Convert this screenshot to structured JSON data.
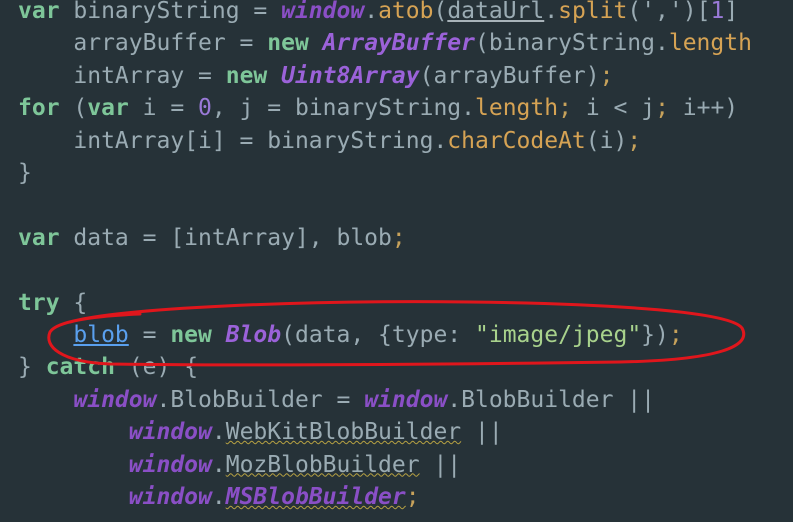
{
  "code_lines": [
    [
      {
        "t": "var",
        "c": "kw"
      },
      {
        "t": " binaryString = ",
        "c": "pl"
      },
      {
        "t": "window",
        "c": "bi"
      },
      {
        "t": ".",
        "c": "pl"
      },
      {
        "t": "atob",
        "c": "fn"
      },
      {
        "t": "(",
        "c": "pl"
      },
      {
        "t": "dataUrl",
        "c": "pl un"
      },
      {
        "t": ".",
        "c": "pl"
      },
      {
        "t": "split",
        "c": "fn"
      },
      {
        "t": "(','",
        "c": "pl"
      },
      {
        "t": ")[",
        "c": "pl"
      },
      {
        "t": "1",
        "c": "nu"
      },
      {
        "t": "]",
        "c": "pl"
      }
    ],
    [
      {
        "t": "    arrayBuffer = ",
        "c": "pl"
      },
      {
        "t": "new",
        "c": "kw"
      },
      {
        "t": " ",
        "c": "pl"
      },
      {
        "t": "ArrayBuffer",
        "c": "cl"
      },
      {
        "t": "(binaryString.",
        "c": "pl"
      },
      {
        "t": "length",
        "c": "fn"
      }
    ],
    [
      {
        "t": "    intArray = ",
        "c": "pl"
      },
      {
        "t": "new",
        "c": "kw"
      },
      {
        "t": " ",
        "c": "pl"
      },
      {
        "t": "Uint8Array",
        "c": "cl"
      },
      {
        "t": "(arrayBuffer)",
        "c": "pl"
      },
      {
        "t": ";",
        "c": "pu"
      }
    ],
    [
      {
        "t": "for",
        "c": "kw"
      },
      {
        "t": " (",
        "c": "pl"
      },
      {
        "t": "var",
        "c": "kw"
      },
      {
        "t": " i = ",
        "c": "pl"
      },
      {
        "t": "0",
        "c": "nu"
      },
      {
        "t": ", j = binaryString.",
        "c": "pl"
      },
      {
        "t": "length",
        "c": "fn"
      },
      {
        "t": ";",
        "c": "pu"
      },
      {
        "t": " i < j",
        "c": "pl"
      },
      {
        "t": ";",
        "c": "pu"
      },
      {
        "t": " i++)",
        "c": "pl"
      }
    ],
    [
      {
        "t": "    intArray[i] = binaryString.",
        "c": "pl"
      },
      {
        "t": "charCodeAt",
        "c": "fn"
      },
      {
        "t": "(i)",
        "c": "pl"
      },
      {
        "t": ";",
        "c": "pu"
      }
    ],
    [
      {
        "t": "}",
        "c": "pl"
      }
    ],
    [],
    [
      {
        "t": "var",
        "c": "kw"
      },
      {
        "t": " data = [intArray], blob",
        "c": "pl"
      },
      {
        "t": ";",
        "c": "pu"
      }
    ],
    [],
    [
      {
        "t": "try",
        "c": "kw"
      },
      {
        "t": " {",
        "c": "pl"
      }
    ],
    [
      {
        "t": "    ",
        "c": "pl"
      },
      {
        "t": "blob",
        "c": "blue"
      },
      {
        "t": " = ",
        "c": "pl"
      },
      {
        "t": "new",
        "c": "kw"
      },
      {
        "t": " ",
        "c": "pl"
      },
      {
        "t": "Blob",
        "c": "cl"
      },
      {
        "t": "(data, {type: ",
        "c": "pl"
      },
      {
        "t": "\"image/jpeg\"",
        "c": "st"
      },
      {
        "t": "})",
        "c": "pl"
      },
      {
        "t": ";",
        "c": "pu"
      }
    ],
    [
      {
        "t": "} ",
        "c": "pl"
      },
      {
        "t": "catch",
        "c": "kw"
      },
      {
        "t": " (e) {",
        "c": "pl"
      }
    ],
    [
      {
        "t": "    ",
        "c": "pl"
      },
      {
        "t": "window",
        "c": "bi"
      },
      {
        "t": ".BlobBuilder = ",
        "c": "pl"
      },
      {
        "t": "window",
        "c": "bi"
      },
      {
        "t": ".BlobBuilder ||",
        "c": "pl"
      }
    ],
    [
      {
        "t": "        ",
        "c": "pl"
      },
      {
        "t": "window",
        "c": "bi"
      },
      {
        "t": ".",
        "c": "pl"
      },
      {
        "t": "WebKitBlobBuilder",
        "c": "pl sq"
      },
      {
        "t": " ||",
        "c": "pl"
      }
    ],
    [
      {
        "t": "        ",
        "c": "pl"
      },
      {
        "t": "window",
        "c": "bi"
      },
      {
        "t": ".",
        "c": "pl"
      },
      {
        "t": "MozBlobBuilder",
        "c": "pl sq"
      },
      {
        "t": " ||",
        "c": "pl"
      }
    ],
    [
      {
        "t": "        ",
        "c": "pl"
      },
      {
        "t": "window",
        "c": "bi"
      },
      {
        "t": ".",
        "c": "pl"
      },
      {
        "t": "MSBlobBuilder",
        "c": "bi sq"
      },
      {
        "t": ";",
        "c": "pu"
      }
    ]
  ],
  "colors": {
    "background": "#263238",
    "keyword": "#7ec699",
    "builtin": "#8a4fc6",
    "function": "#d6a354",
    "string": "#a8d28c",
    "annotation_circle": "#e0161c"
  }
}
